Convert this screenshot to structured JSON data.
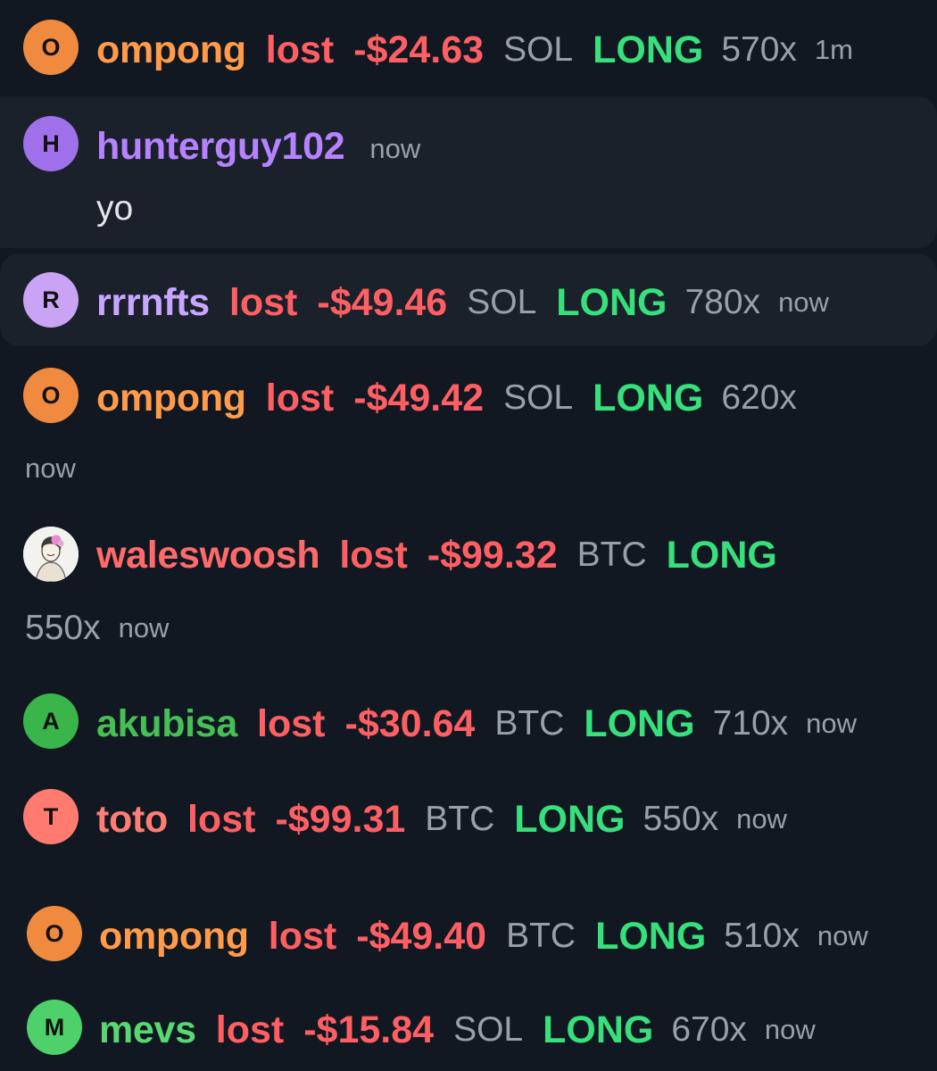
{
  "feed": {
    "events": [
      {
        "avatar": {
          "letter": "O",
          "color": "#ef8a3e"
        },
        "user": "ompong",
        "user_color": "#ff9b4a",
        "verb": "lost",
        "amount": "-$24.63",
        "coin": "SOL",
        "side": "LONG",
        "leverage": "570x",
        "time": "1m"
      },
      {
        "avatar": {
          "letter": "H",
          "color": "#a070ea"
        },
        "user": "hunterguy102",
        "user_color": "#b682ff",
        "time": "now",
        "message": "yo"
      },
      {
        "avatar": {
          "letter": "R",
          "color": "#c9a4f4"
        },
        "user": "rrrnfts",
        "user_color": "#c8a6ff",
        "verb": "lost",
        "amount": "-$49.46",
        "coin": "SOL",
        "side": "LONG",
        "leverage": "780x",
        "time": "now"
      },
      {
        "avatar": {
          "letter": "O",
          "color": "#ef8a3e"
        },
        "user": "ompong",
        "user_color": "#ff9b4a",
        "verb": "lost",
        "amount": "-$49.42",
        "coin": "SOL",
        "side": "LONG",
        "leverage": "620x",
        "time": "now"
      },
      {
        "avatar": {
          "icon": "profile-picture",
          "color": "#f2f2ef"
        },
        "user": "waleswoosh",
        "user_color": "#ff6a6a",
        "verb": "lost",
        "amount": "-$99.32",
        "coin": "BTC",
        "side": "LONG",
        "leverage": "550x",
        "time": "now"
      },
      {
        "avatar": {
          "letter": "A",
          "color": "#3ab54a"
        },
        "user": "akubisa",
        "user_color": "#45c055",
        "verb": "lost",
        "amount": "-$30.64",
        "coin": "BTC",
        "side": "LONG",
        "leverage": "710x",
        "time": "now"
      },
      {
        "avatar": {
          "letter": "T",
          "color": "#ff7b70"
        },
        "user": "toto",
        "user_color": "#ff7d72",
        "verb": "lost",
        "amount": "-$99.31",
        "coin": "BTC",
        "side": "LONG",
        "leverage": "550x",
        "time": "now"
      },
      {
        "avatar": {
          "letter": "O",
          "color": "#ef8a3e"
        },
        "user": "ompong",
        "user_color": "#ff9b4a",
        "verb": "lost",
        "amount": "-$49.40",
        "coin": "BTC",
        "side": "LONG",
        "leverage": "510x",
        "time": "now"
      },
      {
        "avatar": {
          "letter": "M",
          "color": "#4ed06a"
        },
        "user": "mevs",
        "user_color": "#58d872",
        "verb": "lost",
        "amount": "-$15.84",
        "coin": "SOL",
        "side": "LONG",
        "leverage": "670x",
        "time": "now"
      }
    ]
  }
}
